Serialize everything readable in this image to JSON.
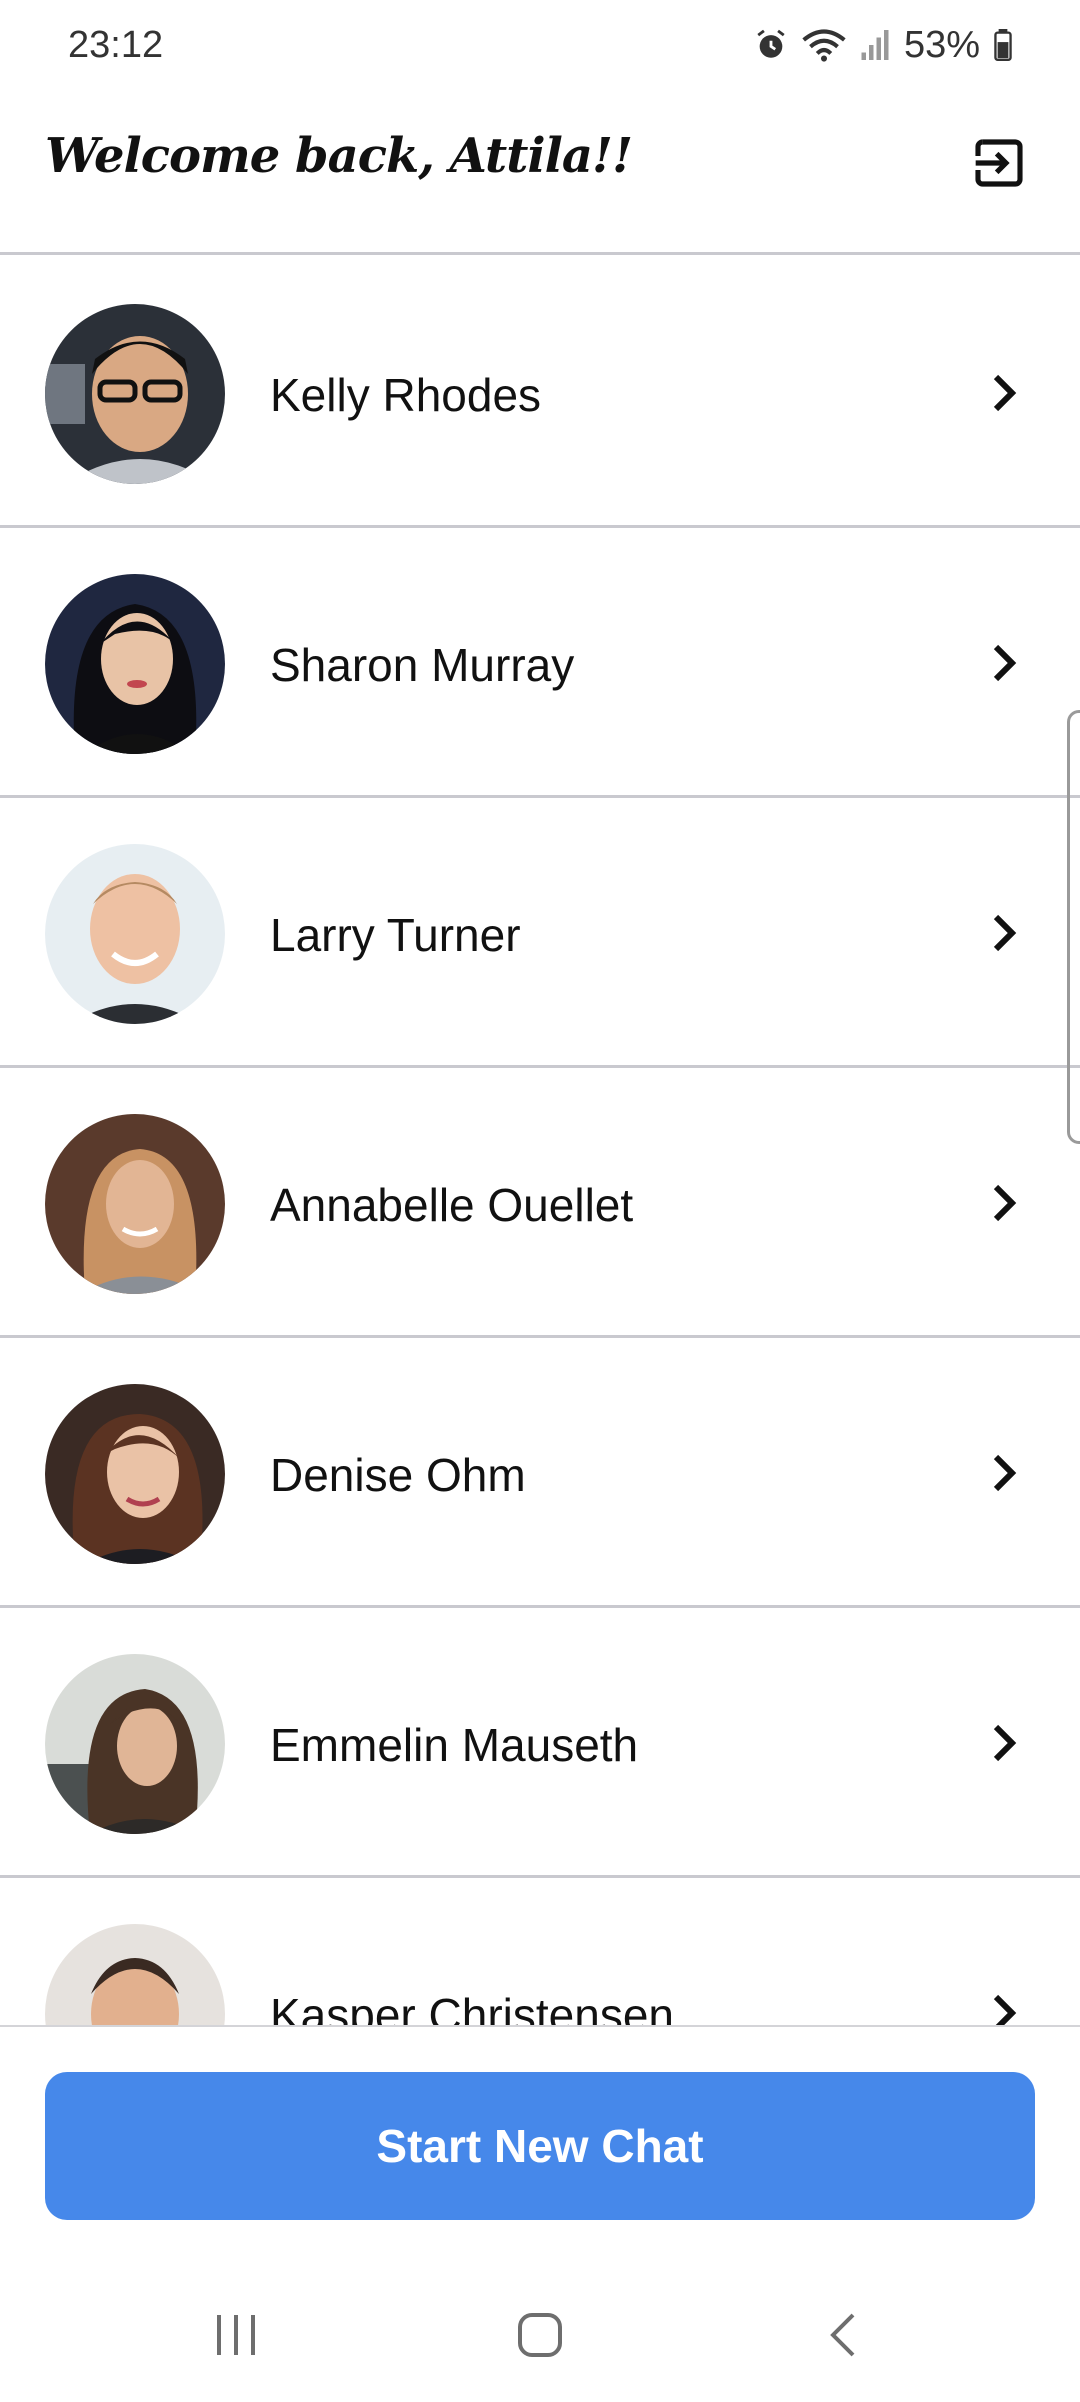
{
  "status_bar": {
    "time": "23:12",
    "battery": "53%"
  },
  "header": {
    "title": "Welcome back, Attila!!"
  },
  "contacts": [
    {
      "name": "Kelly Rhodes"
    },
    {
      "name": "Sharon Murray"
    },
    {
      "name": "Larry Turner"
    },
    {
      "name": "Annabelle Ouellet"
    },
    {
      "name": "Denise Ohm"
    },
    {
      "name": "Emmelin Mauseth"
    },
    {
      "name": "Kasper Christensen"
    }
  ],
  "actions": {
    "start_new_chat": "Start New Chat"
  },
  "colors": {
    "primary_button": "#4688ea",
    "divider": "#c9c9cf"
  }
}
